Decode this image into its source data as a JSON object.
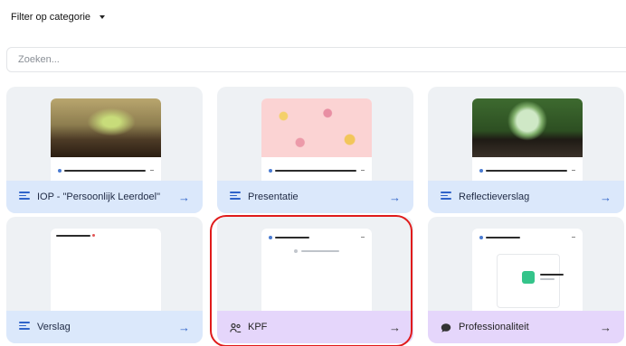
{
  "filter": {
    "label": "Filter op categorie"
  },
  "search": {
    "placeholder": "Zoeken..."
  },
  "cards": [
    {
      "label": "IOP - \"Persoonlijk Leerdoel\"",
      "icon": "lines-icon",
      "theme": "blue"
    },
    {
      "label": "Presentatie",
      "icon": "lines-icon",
      "theme": "blue"
    },
    {
      "label": "Reflectieverslag",
      "icon": "lines-icon",
      "theme": "blue"
    },
    {
      "label": "Verslag",
      "icon": "lines-icon",
      "theme": "blue"
    },
    {
      "label": "KPF",
      "icon": "people-icon",
      "theme": "purple"
    },
    {
      "label": "Professionaliteit",
      "icon": "chat-icon",
      "theme": "purple"
    }
  ],
  "colors": {
    "blue_bar": "#dbe8fb",
    "purple_bar": "#e5d6fb",
    "accent": "#2f63c9",
    "highlight": "#e01b1b"
  }
}
